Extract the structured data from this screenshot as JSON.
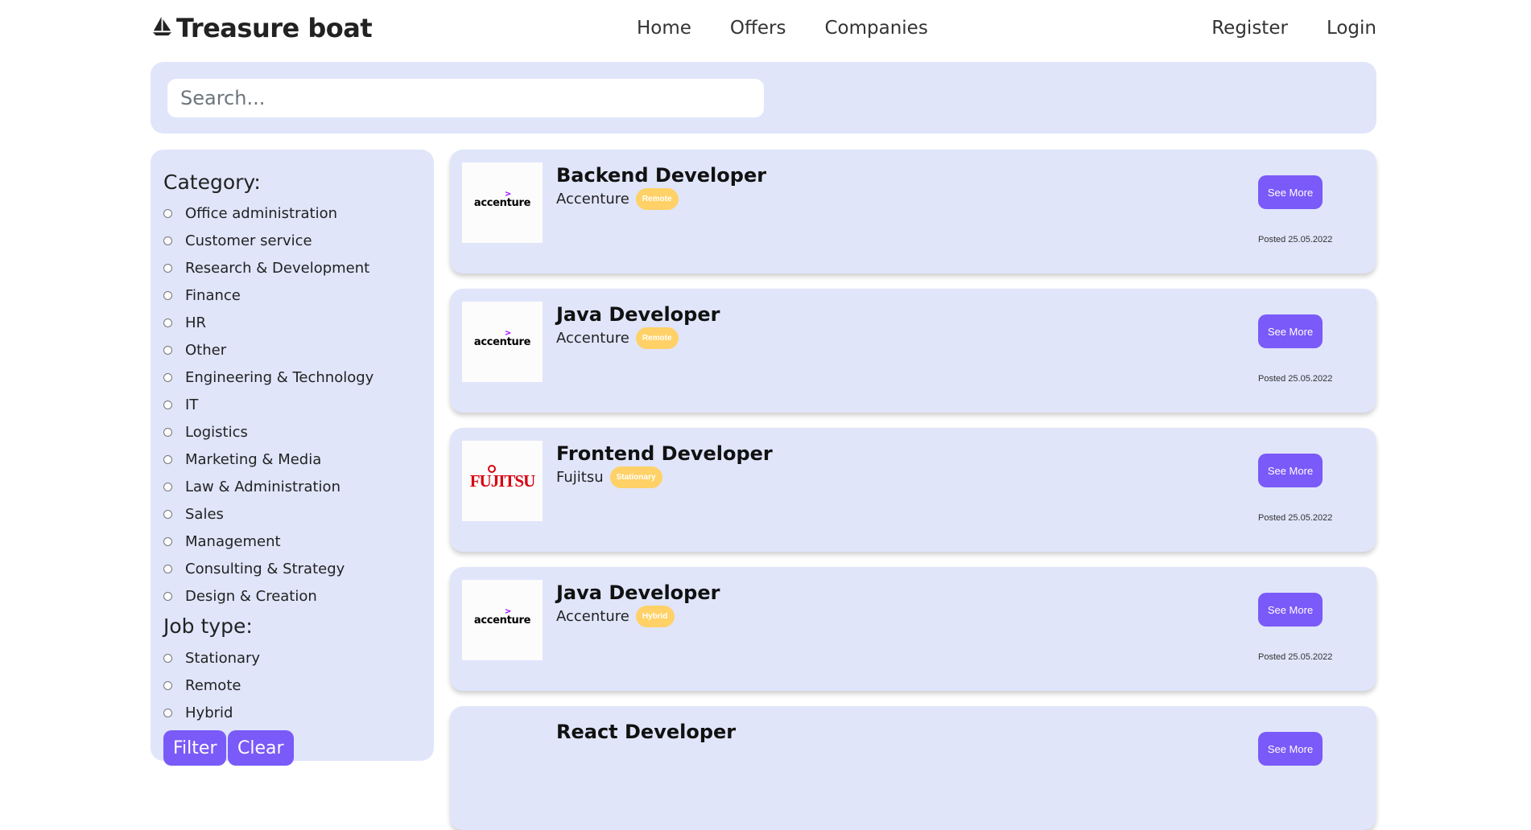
{
  "nav": {
    "brand": "Treasure boat",
    "brand_icon": "sailboat-icon",
    "links": [
      "Home",
      "Offers",
      "Companies"
    ],
    "register": "Register",
    "login": "Login"
  },
  "search": {
    "placeholder": "Search..."
  },
  "filters": {
    "category_title": "Category:",
    "categories": [
      "Office administration",
      "Customer service",
      "Research & Development",
      "Finance",
      "HR",
      "Other",
      "Engineering & Technology",
      "IT",
      "Logistics",
      "Marketing & Media",
      "Law & Administration",
      "Sales",
      "Management",
      "Consulting & Strategy",
      "Design & Creation"
    ],
    "jobtype_title": "Job type:",
    "job_types": [
      "Stationary",
      "Remote",
      "Hybrid"
    ],
    "filter_label": "Filter",
    "clear_label": "Clear"
  },
  "offers": [
    {
      "title": "Backend Developer",
      "company": "Accenture",
      "type": "Remote",
      "button": "See More",
      "posted": "Posted 25.05.2022",
      "logo": "accenture"
    },
    {
      "title": "Java Developer",
      "company": "Accenture",
      "type": "Remote",
      "button": "See More",
      "posted": "Posted 25.05.2022",
      "logo": "accenture"
    },
    {
      "title": "Frontend Developer",
      "company": "Fujitsu",
      "type": "Stationary",
      "button": "See More",
      "posted": "Posted 25.05.2022",
      "logo": "fujitsu"
    },
    {
      "title": "Java Developer",
      "company": "Accenture",
      "type": "Hybrid",
      "button": "See More",
      "posted": "Posted 25.05.2022",
      "logo": "accenture"
    },
    {
      "title": "React Developer",
      "company": "",
      "type": "",
      "button": "See More",
      "posted": "",
      "logo": ""
    }
  ],
  "logos": {
    "accenture": "accenture",
    "fujitsu": "FUJITSU"
  },
  "colors": {
    "panel": "#e0e5fa",
    "accent": "#7a5af8",
    "badge": "#ffd166"
  }
}
